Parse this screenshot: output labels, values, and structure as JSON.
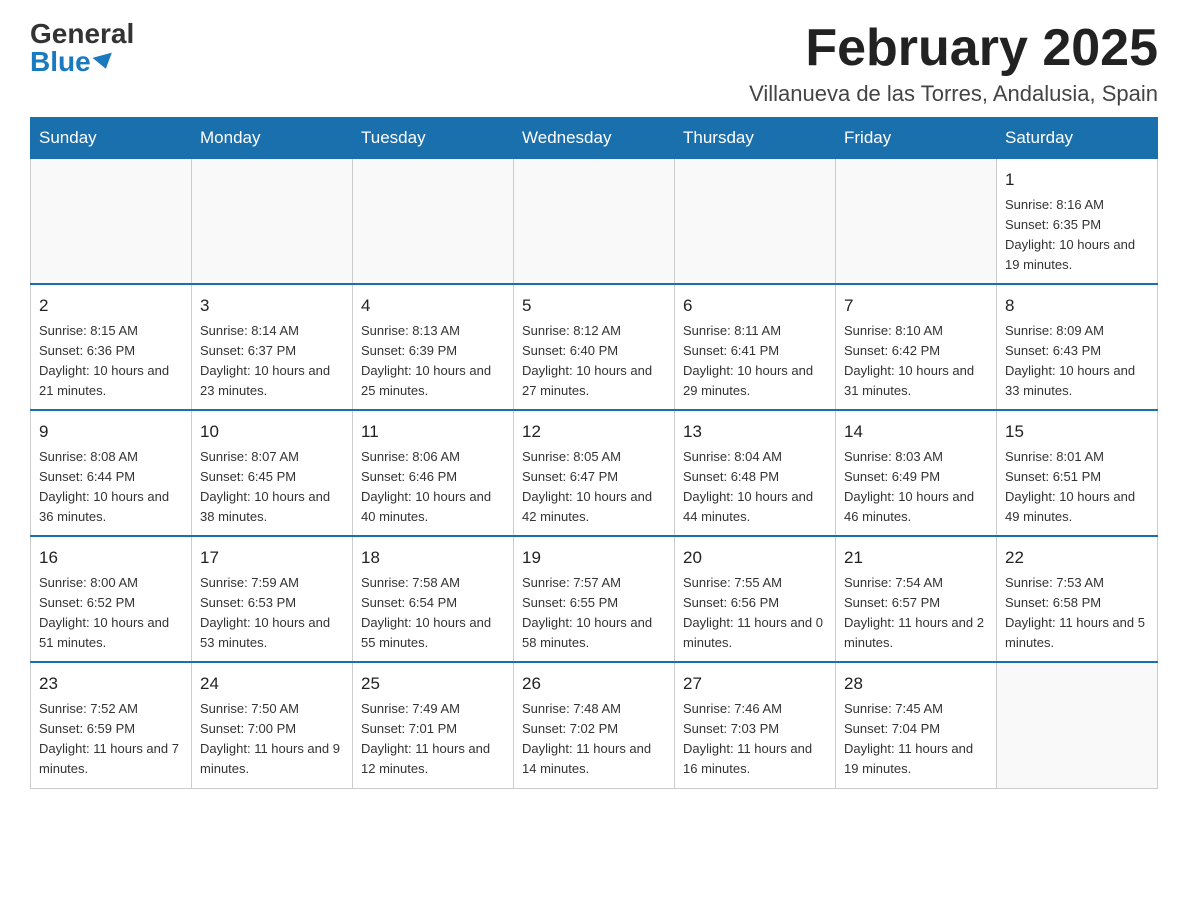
{
  "header": {
    "logo_general": "General",
    "logo_blue": "Blue",
    "month_title": "February 2025",
    "location": "Villanueva de las Torres, Andalusia, Spain"
  },
  "days_of_week": [
    "Sunday",
    "Monday",
    "Tuesday",
    "Wednesday",
    "Thursday",
    "Friday",
    "Saturday"
  ],
  "weeks": [
    [
      {
        "day": "",
        "info": ""
      },
      {
        "day": "",
        "info": ""
      },
      {
        "day": "",
        "info": ""
      },
      {
        "day": "",
        "info": ""
      },
      {
        "day": "",
        "info": ""
      },
      {
        "day": "",
        "info": ""
      },
      {
        "day": "1",
        "info": "Sunrise: 8:16 AM\nSunset: 6:35 PM\nDaylight: 10 hours and 19 minutes."
      }
    ],
    [
      {
        "day": "2",
        "info": "Sunrise: 8:15 AM\nSunset: 6:36 PM\nDaylight: 10 hours and 21 minutes."
      },
      {
        "day": "3",
        "info": "Sunrise: 8:14 AM\nSunset: 6:37 PM\nDaylight: 10 hours and 23 minutes."
      },
      {
        "day": "4",
        "info": "Sunrise: 8:13 AM\nSunset: 6:39 PM\nDaylight: 10 hours and 25 minutes."
      },
      {
        "day": "5",
        "info": "Sunrise: 8:12 AM\nSunset: 6:40 PM\nDaylight: 10 hours and 27 minutes."
      },
      {
        "day": "6",
        "info": "Sunrise: 8:11 AM\nSunset: 6:41 PM\nDaylight: 10 hours and 29 minutes."
      },
      {
        "day": "7",
        "info": "Sunrise: 8:10 AM\nSunset: 6:42 PM\nDaylight: 10 hours and 31 minutes."
      },
      {
        "day": "8",
        "info": "Sunrise: 8:09 AM\nSunset: 6:43 PM\nDaylight: 10 hours and 33 minutes."
      }
    ],
    [
      {
        "day": "9",
        "info": "Sunrise: 8:08 AM\nSunset: 6:44 PM\nDaylight: 10 hours and 36 minutes."
      },
      {
        "day": "10",
        "info": "Sunrise: 8:07 AM\nSunset: 6:45 PM\nDaylight: 10 hours and 38 minutes."
      },
      {
        "day": "11",
        "info": "Sunrise: 8:06 AM\nSunset: 6:46 PM\nDaylight: 10 hours and 40 minutes."
      },
      {
        "day": "12",
        "info": "Sunrise: 8:05 AM\nSunset: 6:47 PM\nDaylight: 10 hours and 42 minutes."
      },
      {
        "day": "13",
        "info": "Sunrise: 8:04 AM\nSunset: 6:48 PM\nDaylight: 10 hours and 44 minutes."
      },
      {
        "day": "14",
        "info": "Sunrise: 8:03 AM\nSunset: 6:49 PM\nDaylight: 10 hours and 46 minutes."
      },
      {
        "day": "15",
        "info": "Sunrise: 8:01 AM\nSunset: 6:51 PM\nDaylight: 10 hours and 49 minutes."
      }
    ],
    [
      {
        "day": "16",
        "info": "Sunrise: 8:00 AM\nSunset: 6:52 PM\nDaylight: 10 hours and 51 minutes."
      },
      {
        "day": "17",
        "info": "Sunrise: 7:59 AM\nSunset: 6:53 PM\nDaylight: 10 hours and 53 minutes."
      },
      {
        "day": "18",
        "info": "Sunrise: 7:58 AM\nSunset: 6:54 PM\nDaylight: 10 hours and 55 minutes."
      },
      {
        "day": "19",
        "info": "Sunrise: 7:57 AM\nSunset: 6:55 PM\nDaylight: 10 hours and 58 minutes."
      },
      {
        "day": "20",
        "info": "Sunrise: 7:55 AM\nSunset: 6:56 PM\nDaylight: 11 hours and 0 minutes."
      },
      {
        "day": "21",
        "info": "Sunrise: 7:54 AM\nSunset: 6:57 PM\nDaylight: 11 hours and 2 minutes."
      },
      {
        "day": "22",
        "info": "Sunrise: 7:53 AM\nSunset: 6:58 PM\nDaylight: 11 hours and 5 minutes."
      }
    ],
    [
      {
        "day": "23",
        "info": "Sunrise: 7:52 AM\nSunset: 6:59 PM\nDaylight: 11 hours and 7 minutes."
      },
      {
        "day": "24",
        "info": "Sunrise: 7:50 AM\nSunset: 7:00 PM\nDaylight: 11 hours and 9 minutes."
      },
      {
        "day": "25",
        "info": "Sunrise: 7:49 AM\nSunset: 7:01 PM\nDaylight: 11 hours and 12 minutes."
      },
      {
        "day": "26",
        "info": "Sunrise: 7:48 AM\nSunset: 7:02 PM\nDaylight: 11 hours and 14 minutes."
      },
      {
        "day": "27",
        "info": "Sunrise: 7:46 AM\nSunset: 7:03 PM\nDaylight: 11 hours and 16 minutes."
      },
      {
        "day": "28",
        "info": "Sunrise: 7:45 AM\nSunset: 7:04 PM\nDaylight: 11 hours and 19 minutes."
      },
      {
        "day": "",
        "info": ""
      }
    ]
  ]
}
